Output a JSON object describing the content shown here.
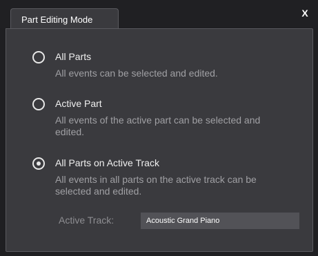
{
  "dialog": {
    "tab_title": "Part Editing Mode",
    "close_label": "X"
  },
  "options": [
    {
      "label": "All Parts",
      "description": "All events can be selected and edited.",
      "selected": false
    },
    {
      "label": "Active Part",
      "description": "All events of the active part can be selected and edited.",
      "selected": false
    },
    {
      "label": "All Parts on Active Track",
      "description": "All events in all parts on the active track can be selected and edited.",
      "selected": true
    }
  ],
  "active_track": {
    "label": "Active Track:",
    "value": "Acoustic Grand Piano"
  }
}
